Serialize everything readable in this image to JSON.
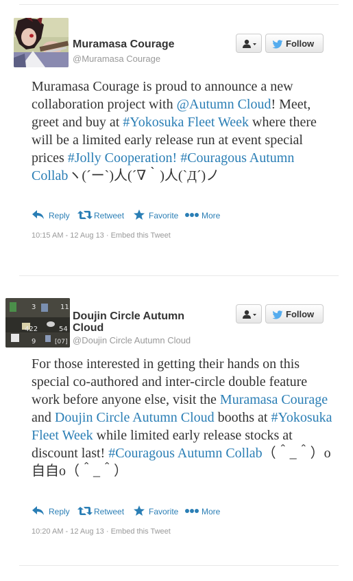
{
  "tweets": [
    {
      "name": "Muramasa Courage",
      "handle": "@Muramasa Courage",
      "follow_label": "Follow",
      "text_parts": [
        "Muramasa Courage is proud to announce a new collaboration project with ",
        "@Autumn Cloud",
        "! Meet, greet and buy at ",
        "#Yokosuka Fleet Week",
        " where there will be a limited early release run at event special prices ",
        "#Jolly Cooperation!",
        " ",
        "#Couragous Autumn Collab",
        "ヽ(´ー`)人(´∇｀)人(`Д´)ノ"
      ],
      "actions": {
        "reply": "Reply",
        "retweet": "Retweet",
        "favorite": "Favorite",
        "more": "More"
      },
      "timestamp": "10:15 AM - 12 Aug 13",
      "embed": "Embed this Tweet",
      "meta_sep": " · "
    },
    {
      "name": "Doujin Circle Autumn Cloud",
      "handle": "@Doujin Circle Autumn Cloud",
      "follow_label": "Follow",
      "avatar_text": {
        "a": "3",
        "b": "11",
        "c": "422",
        "d": "54",
        "e": "9",
        "f": "[07]"
      },
      "text_parts": [
        "For those interested in getting their hands on this special co-authored and inter-circle double feature work before anyone else, visit the ",
        "Muramasa Courage",
        " and ",
        "Doujin Circle Autumn Cloud",
        " booths at ",
        "#Yokosuka Fleet Week",
        " while limited early release stocks at discount last! ",
        "#Couragous Autumn Collab",
        "（＾_＾）o自自o（＾_＾）"
      ],
      "actions": {
        "reply": "Reply",
        "retweet": "Retweet",
        "favorite": "Favorite",
        "more": "More"
      },
      "timestamp": "10:20 AM - 12 Aug 13",
      "embed": "Embed this Tweet",
      "meta_sep": " · "
    }
  ],
  "colors": {
    "link": "#2a7eb5",
    "text": "#333333",
    "muted": "#999999",
    "twitter_bird": "#55acee",
    "separator": "#e8e8e8"
  }
}
